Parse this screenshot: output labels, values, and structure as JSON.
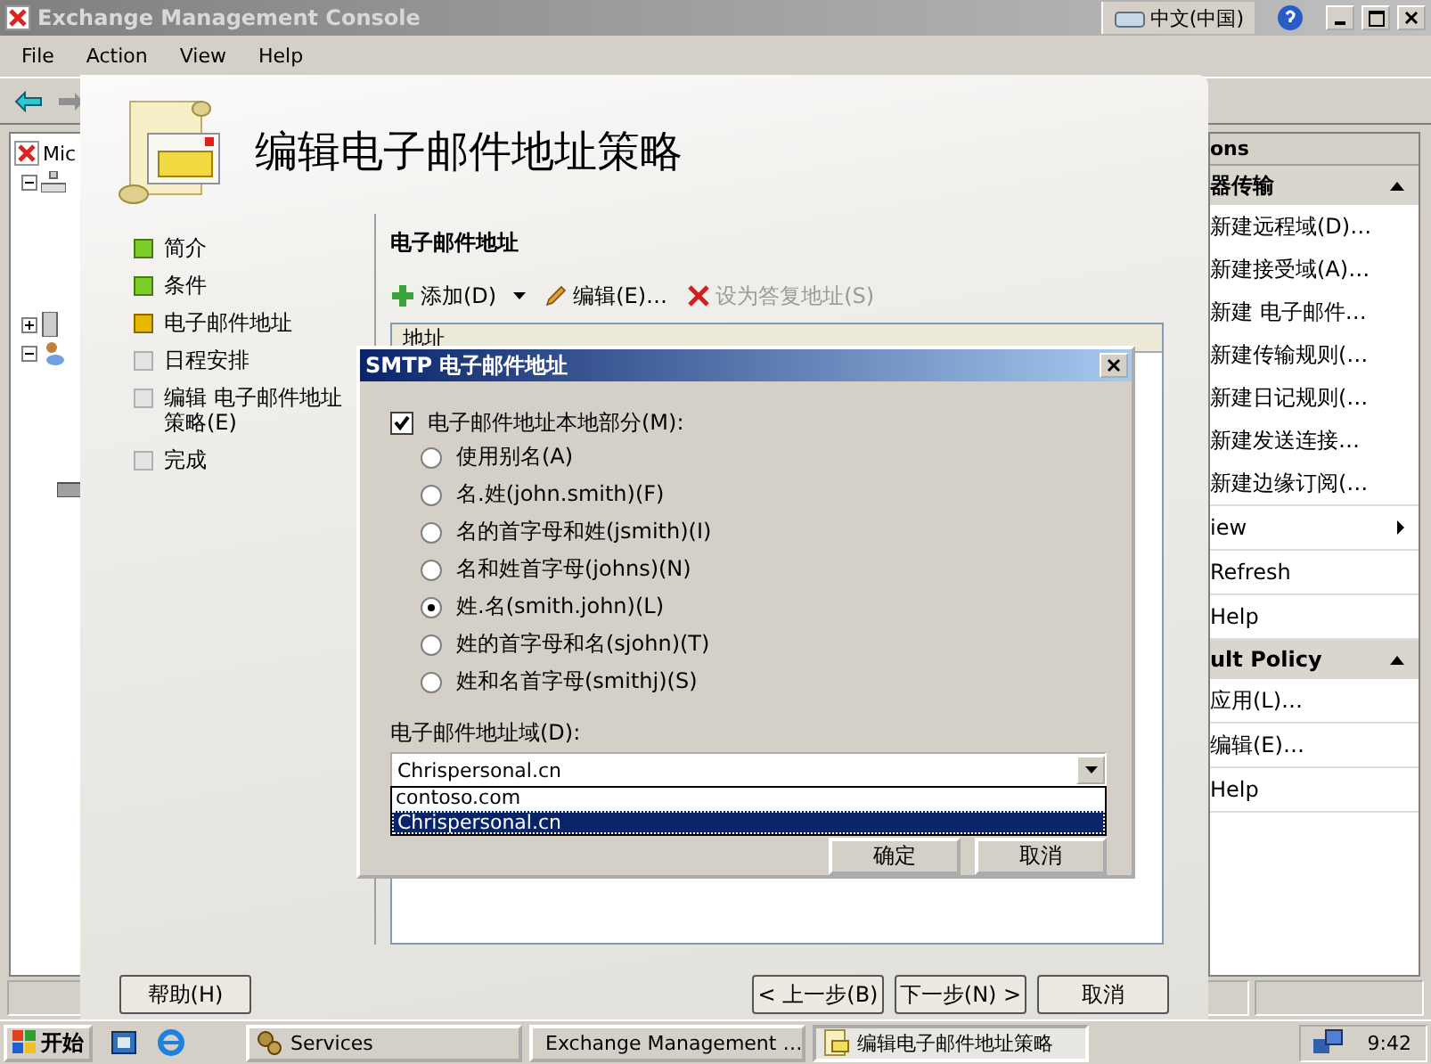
{
  "console": {
    "title": "Exchange Management Console",
    "language": "中文(中国)",
    "menu": [
      "File",
      "Action",
      "View",
      "Help"
    ],
    "tree_root": "Mic",
    "actions": {
      "header": "ons",
      "sections": [
        {
          "title": "器传输",
          "groups": [
            [
              {
                "label": "新建远程域(D)…",
                "submenu": false
              },
              {
                "label": "新建接受域(A)…",
                "submenu": false
              },
              {
                "label": "新建 电子邮件…",
                "submenu": false
              },
              {
                "label": "新建传输规则(…",
                "submenu": false
              },
              {
                "label": "新建日记规则(…",
                "submenu": false
              },
              {
                "label": "新建发送连接…",
                "submenu": false
              },
              {
                "label": "新建边缘订阅(…",
                "submenu": false
              }
            ],
            [
              {
                "label": "iew",
                "submenu": true
              }
            ],
            [
              {
                "label": "Refresh",
                "submenu": false
              }
            ],
            [
              {
                "label": "Help",
                "submenu": false
              }
            ]
          ]
        },
        {
          "title": "ult Policy",
          "groups": [
            [
              {
                "label": "应用(L)…",
                "submenu": false
              }
            ],
            [
              {
                "label": "编辑(E)…",
                "submenu": false
              }
            ],
            [
              {
                "label": "Help",
                "submenu": false
              }
            ]
          ]
        }
      ]
    }
  },
  "wizard": {
    "title": "编辑电子邮件地址策略",
    "steps": [
      {
        "label": "简介",
        "kind": "done"
      },
      {
        "label": "条件",
        "kind": "done"
      },
      {
        "label": "电子邮件地址",
        "kind": "current"
      },
      {
        "label": "日程安排",
        "kind": "pending"
      },
      {
        "label": "编辑 电子邮件地址策略(E)",
        "kind": "pending"
      },
      {
        "label": "完成",
        "kind": "pending"
      }
    ],
    "section_title": "电子邮件地址",
    "toolbar": [
      {
        "label": "添加(D)",
        "kind": "add",
        "disabled": false
      },
      {
        "label": "编辑(E)…",
        "kind": "edit",
        "disabled": false
      },
      {
        "label": "设为答复地址(S)",
        "kind": "remove",
        "disabled": true
      }
    ],
    "list_header": "地址",
    "buttons": [
      "帮助(H)",
      "< 上一步(B)",
      "下一步(N) >",
      "取消"
    ]
  },
  "dialog": {
    "title": "SMTP 电子邮件地址",
    "local_part": {
      "label": "电子邮件地址本地部分(M):",
      "checked": true
    },
    "formats": [
      {
        "label": "使用别名(A)",
        "selected": false
      },
      {
        "label": "名.姓(john.smith)(F)",
        "selected": false
      },
      {
        "label": "名的首字母和姓(jsmith)(I)",
        "selected": false
      },
      {
        "label": "名和姓首字母(johns)(N)",
        "selected": false
      },
      {
        "label": "姓.名(smith.john)(L)",
        "selected": true
      },
      {
        "label": "姓的首字母和名(sjohn)(T)",
        "selected": false
      },
      {
        "label": "姓和名首字母(smithj)(S)",
        "selected": false
      }
    ],
    "domain_label": "电子邮件地址域(D):",
    "domain_value": "Chrispersonal.cn",
    "domain_options": [
      {
        "label": "contoso.com",
        "selected": false
      },
      {
        "label": "Chrispersonal.cn",
        "selected": true
      }
    ],
    "buttons": [
      "确定",
      "取消"
    ]
  },
  "taskbar": {
    "start": "开始",
    "items": [
      {
        "label": "Services",
        "kind": "services",
        "selected": false
      },
      {
        "label": "Exchange Management …",
        "kind": "exchange",
        "selected": false
      },
      {
        "label": "编辑电子邮件地址策略",
        "kind": "wizard",
        "selected": true
      }
    ],
    "clock": "9:42"
  }
}
